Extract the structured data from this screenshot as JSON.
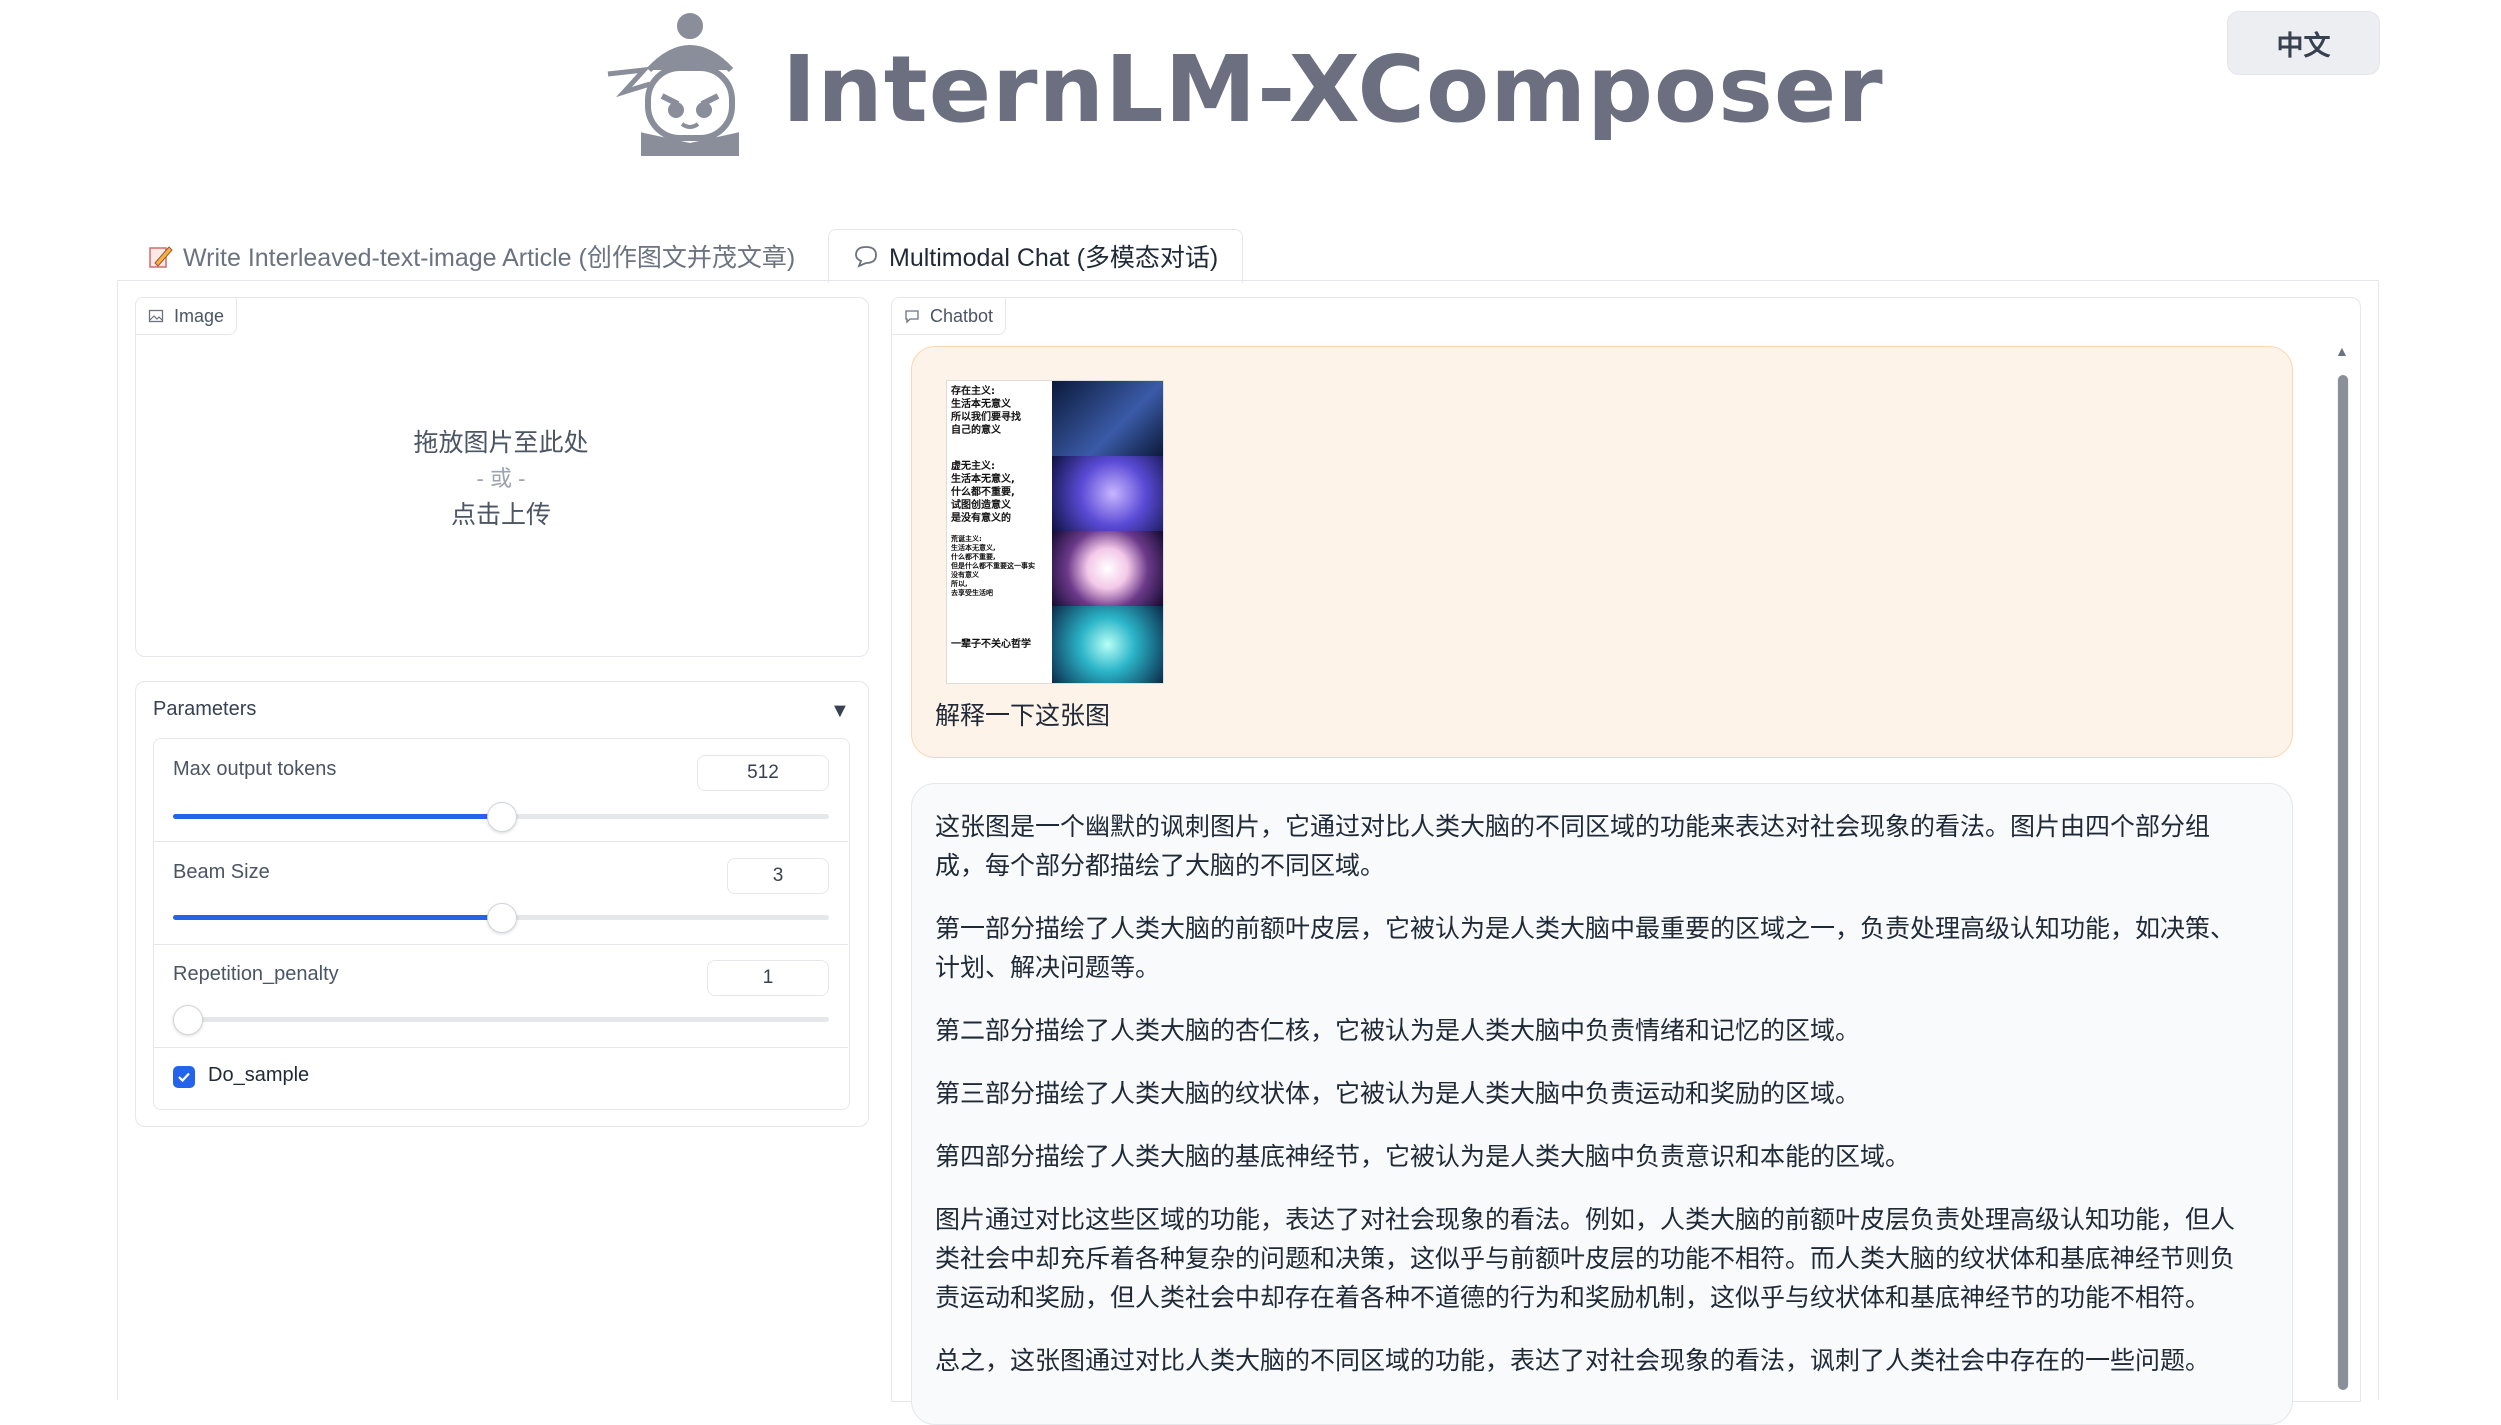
{
  "app": {
    "title": "InternLM-XComposer",
    "lang_button": "中文"
  },
  "tabs": [
    {
      "label": "Write Interleaved-text-image Article (创作图文并茂文章)",
      "active": false,
      "icon": "pencil-paper-icon"
    },
    {
      "label": "Multimodal Chat (多模态对话)",
      "active": true,
      "icon": "chat-bubble-icon"
    }
  ],
  "image_upload": {
    "label": "Image",
    "drop_text": "拖放图片至此处",
    "or_text": "- 或 -",
    "click_text": "点击上传"
  },
  "parameters": {
    "title": "Parameters",
    "toggle": "▼",
    "max_tokens": {
      "label": "Max output tokens",
      "value": "512",
      "slider_fraction": 0.5
    },
    "beam_size": {
      "label": "Beam Size",
      "value": "3",
      "slider_fraction": 0.5
    },
    "repetition_penalty": {
      "label": "Repetition_penalty",
      "value": "1",
      "slider_fraction": 0.0
    },
    "do_sample": {
      "label": "Do_sample",
      "checked": true
    }
  },
  "chatbot": {
    "label": "Chatbot",
    "user_message": "解释一下这张图",
    "user_image_panels": [
      "存在主义:\n生活本无意义\n所以我们要寻找\n自己的意义",
      "虚无主义:\n生活本无意义,\n什么都不重要,\n试图创造意义\n是没有意义的",
      "荒诞主义:\n生活本无意义,\n什么都不重要,\n但是什么都不重要这一事实\n没有意义\n所以,\n去享受生活吧",
      "一辈子不关心哲学"
    ],
    "bot_paragraphs": [
      "这张图是一个幽默的讽刺图片，它通过对比人类大脑的不同区域的功能来表达对社会现象的看法。图片由四个部分组成，每个部分都描绘了大脑的不同区域。",
      "第一部分描绘了人类大脑的前额叶皮层，它被认为是人类大脑中最重要的区域之一，负责处理高级认知功能，如决策、计划、解决问题等。",
      "第二部分描绘了人类大脑的杏仁核，它被认为是人类大脑中负责情绪和记忆的区域。",
      "第三部分描绘了人类大脑的纹状体，它被认为是人类大脑中负责运动和奖励的区域。",
      "第四部分描绘了人类大脑的基底神经节，它被认为是人类大脑中负责意识和本能的区域。",
      "图片通过对比这些区域的功能，表达了对社会现象的看法。例如，人类大脑的前额叶皮层负责处理高级认知功能，但人类社会中却充斥着各种复杂的问题和决策，这似乎与前额叶皮层的功能不相符。而人类大脑的纹状体和基底神经节则负责运动和奖励，但人类社会中却存在着各种不道德的行为和奖励机制，这似乎与纹状体和基底神经节的功能不相符。",
      "总之，这张图通过对比人类大脑的不同区域的功能，表达了对社会现象的看法，讽刺了人类社会中存在的一些问题。"
    ]
  }
}
